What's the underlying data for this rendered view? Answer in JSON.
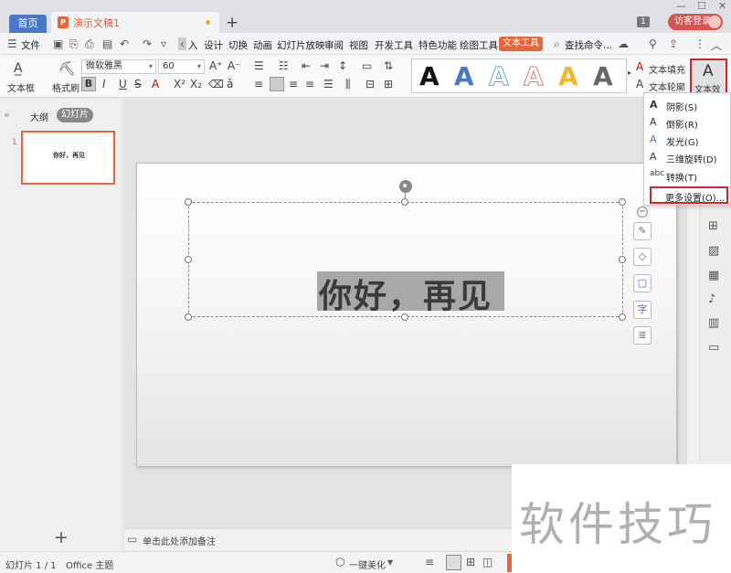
{
  "titlebar": {
    "home_tab": "首页",
    "doc_tab": "演示文稿1",
    "doc_icon": "P",
    "add_tab": "+",
    "badge": "1",
    "visitor_login": "访客登录"
  },
  "menubar": {
    "file": "文件",
    "items": [
      "入",
      "设计",
      "切换",
      "动画",
      "幻灯片放映",
      "审阅",
      "视图",
      "开发工具",
      "特色功能",
      "绘图工具"
    ],
    "text_tool_tab": "文本工具",
    "search": "查找命令..."
  },
  "ribbon": {
    "textbox_label": "文本框",
    "format_brush_label": "格式刷",
    "font_name": "微软雅黑",
    "font_size": "60",
    "bold": "B",
    "italic": "I",
    "underline": "U",
    "strike": "S",
    "text_fill": "文本填充",
    "text_outline": "文本轮廓",
    "text_effect": "文本效",
    "gallery_letters": [
      "A",
      "A",
      "A",
      "A",
      "A",
      "A"
    ]
  },
  "dropdown": {
    "items": [
      {
        "icon": "A",
        "label": "阴影(S)"
      },
      {
        "icon": "A",
        "label": "倒影(R)"
      },
      {
        "icon": "A",
        "label": "发光(G)"
      },
      {
        "icon": "A",
        "label": "三维旋转(D)"
      },
      {
        "icon": "abc",
        "label": "转换(T)"
      }
    ],
    "more": "更多设置(O)..."
  },
  "leftpanel": {
    "outline_tab": "大纲",
    "slides_tab": "幻灯片",
    "slide_number": "1",
    "thumb_text": "你好，再见",
    "add_slide": "+"
  },
  "slide": {
    "text": "你好，再见"
  },
  "notes": {
    "placeholder": "单击此处添加备注"
  },
  "statusbar": {
    "slide_count": "幻灯片 1 / 1",
    "theme": "Office 主题",
    "beautify": "一键美化"
  },
  "watermark": "软件技巧"
}
